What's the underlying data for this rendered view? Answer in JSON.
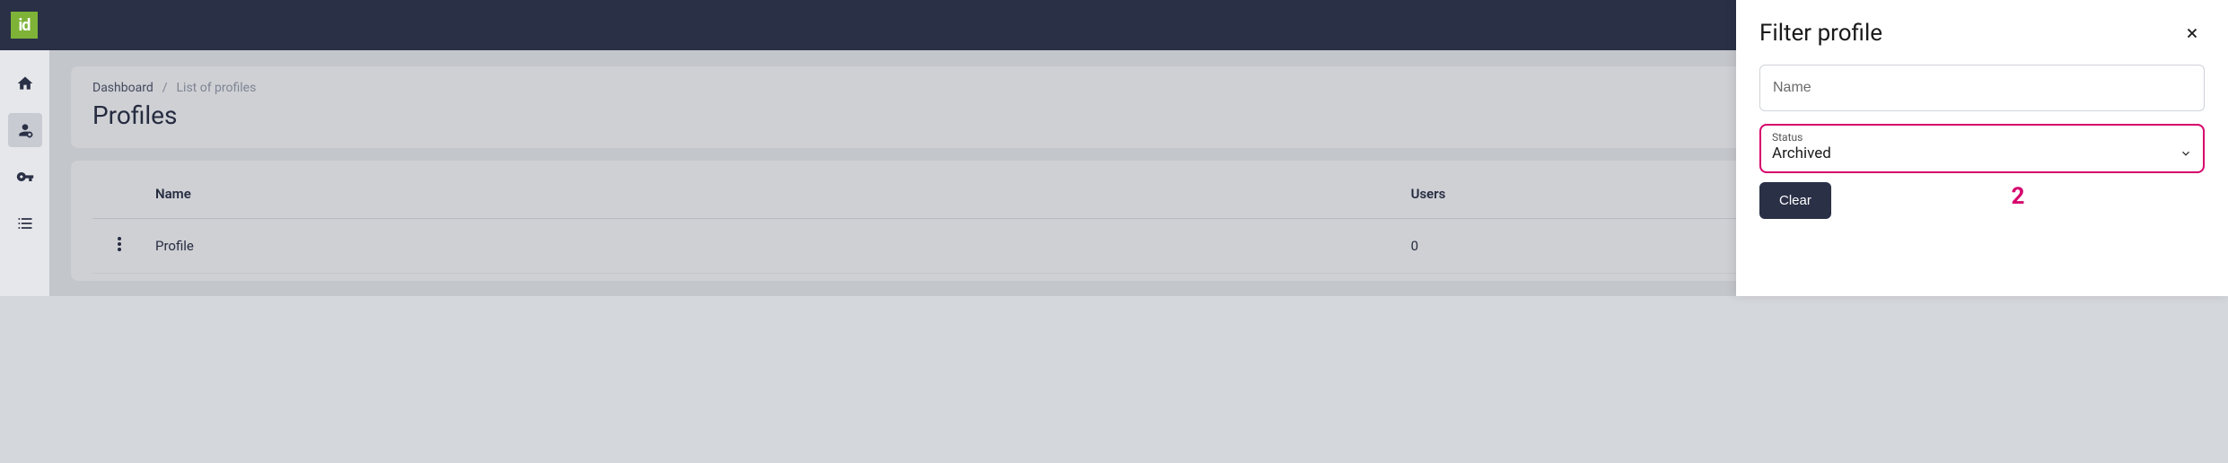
{
  "app": {
    "logo_text": "id"
  },
  "breadcrumb": {
    "root": "Dashboard",
    "separator": "/",
    "current": "List of profiles"
  },
  "page": {
    "title": "Profiles"
  },
  "table": {
    "columns": {
      "name": "Name",
      "users": "Users"
    },
    "rows": [
      {
        "name": "Profile",
        "users": "0"
      }
    ]
  },
  "filter": {
    "title": "Filter profile",
    "name_placeholder": "Name",
    "name_value": "",
    "status_label": "Status",
    "status_value": "Archived",
    "clear_label": "Clear",
    "annotation": "2"
  },
  "colors": {
    "topbar": "#2a3046",
    "logo_bg": "#7eb338",
    "highlight": "#d6006c"
  }
}
